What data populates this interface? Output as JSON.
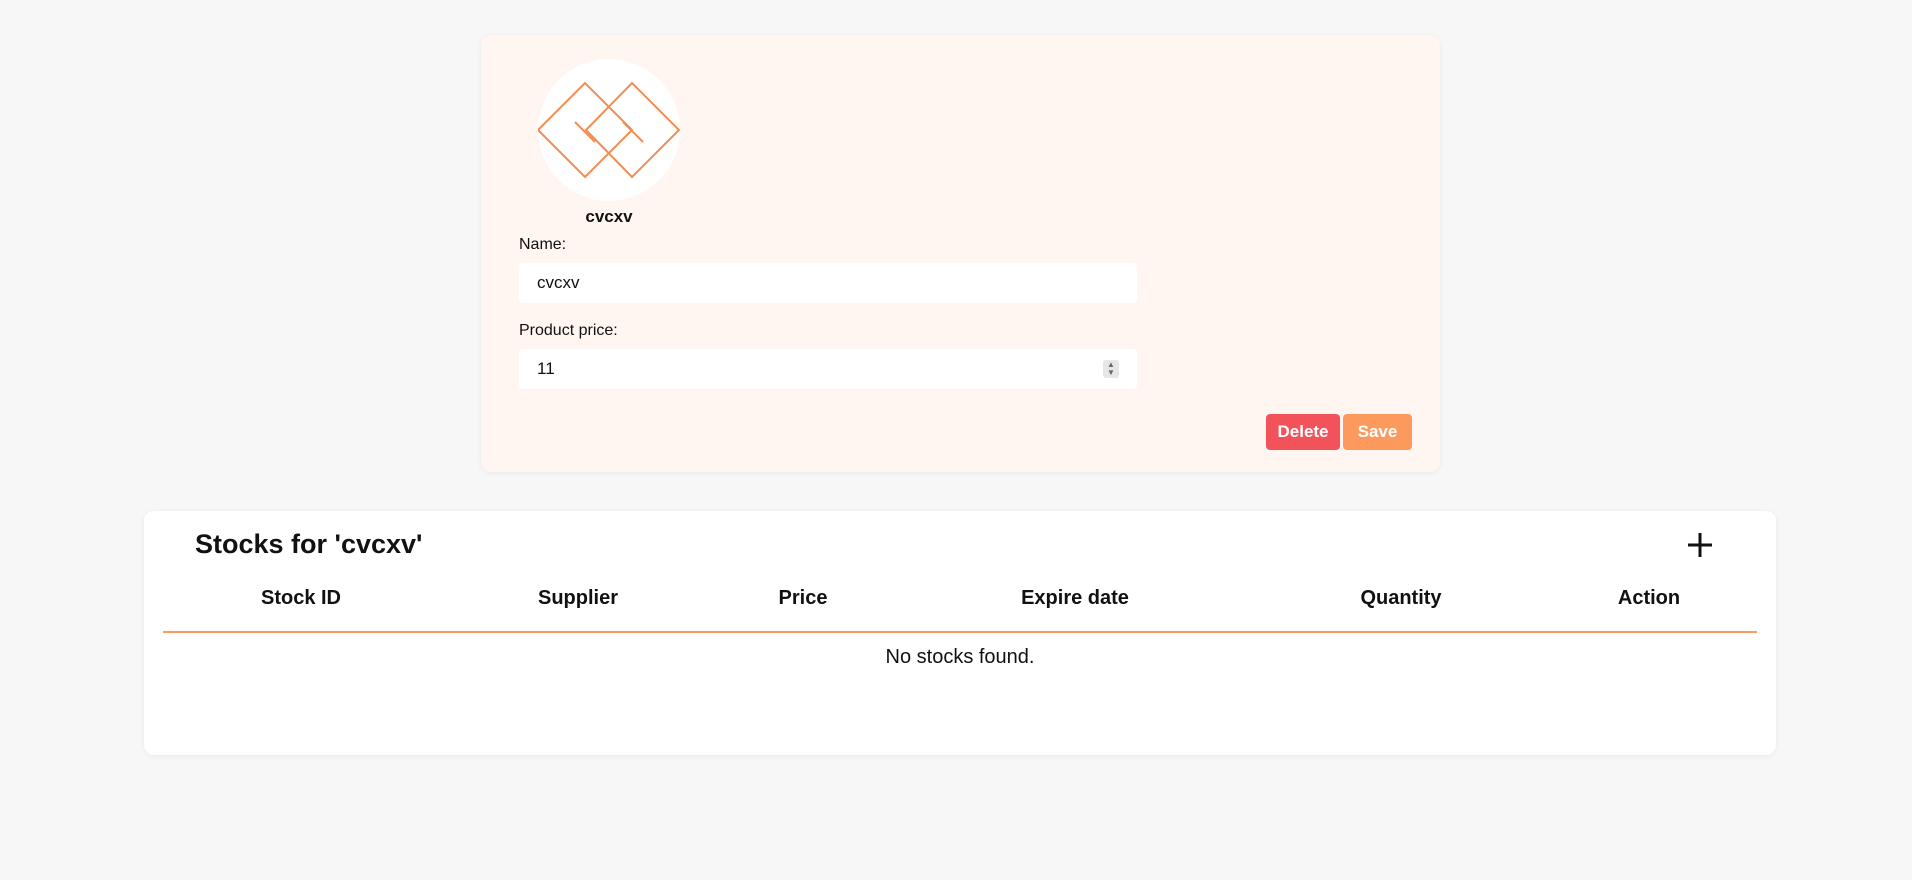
{
  "product": {
    "avatar_icon": "geometric-diamonds-logo",
    "name": "cvcxv",
    "name_label": "Name:",
    "name_value": "cvcxv",
    "price_label": "Product price:",
    "price_value": "11",
    "delete_label": "Delete",
    "save_label": "Save"
  },
  "stocks": {
    "title": "Stocks for 'cvcxv'",
    "add_icon": "plus-icon",
    "columns": [
      "Stock ID",
      "Supplier",
      "Price",
      "Expire date",
      "Quantity",
      "Action"
    ],
    "empty_message": "No stocks found."
  },
  "colors": {
    "page_background": "#f6f7f6",
    "product_card_background": "#fff5f1",
    "accent": "#fc9a5e",
    "delete": "#f2535b"
  }
}
